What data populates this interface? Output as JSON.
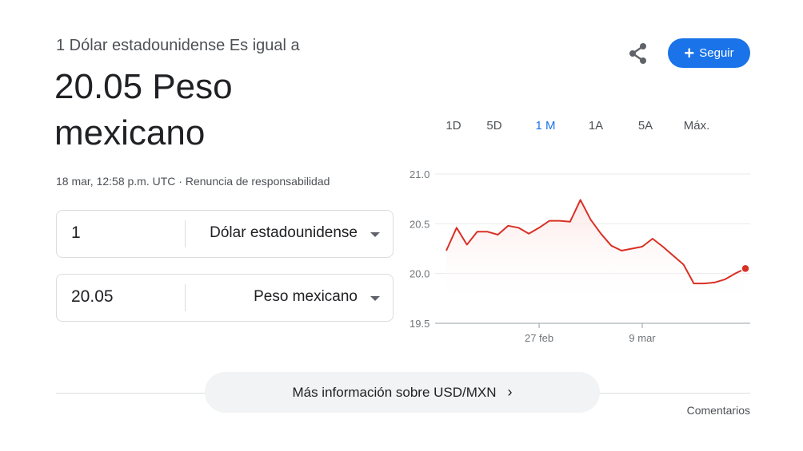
{
  "header": {
    "subtitle": "1 Dólar estadounidense Es igual a",
    "value_line1": "20.05 Peso",
    "value_line2": "mexicano",
    "timestamp": "18 mar, 12:58 p.m. UTC · ",
    "disclaimer": "Renuncia de responsabilidad"
  },
  "actions": {
    "share_icon": "share-icon",
    "follow_label": "Seguir",
    "follow_icon": "+"
  },
  "converter": {
    "from": {
      "amount": "1",
      "unit": "Dólar estadounidense"
    },
    "to": {
      "amount": "20.05",
      "unit": "Peso mexicano"
    }
  },
  "range_tabs": {
    "items": [
      "1D",
      "5D",
      "1 M",
      "1A",
      "5A",
      "Máx."
    ],
    "selected": "1 M"
  },
  "chart_data": {
    "type": "area",
    "x_ticks": [
      "27 feb",
      "9 mar"
    ],
    "y_ticks": [
      "21.0",
      "20.5",
      "20.0",
      "19.5"
    ],
    "ylim": [
      19.5,
      21.0
    ],
    "grid": true,
    "x_index_range": [
      0,
      29
    ],
    "x_tick_positions": [
      9,
      19
    ],
    "color": "#d93025",
    "series": [
      {
        "values": [
          20.23,
          20.46,
          20.29,
          20.42,
          20.42,
          20.39,
          20.48,
          20.46,
          20.4,
          20.46,
          20.53,
          20.53,
          20.52,
          20.74,
          20.54,
          20.4,
          20.28,
          20.23,
          20.25,
          20.27,
          20.35,
          20.27,
          20.18,
          20.09,
          19.9,
          19.9,
          19.91,
          19.94,
          20.0,
          20.05
        ]
      }
    ]
  },
  "footer": {
    "more_info": "Más información sobre USD/MXN",
    "more_info_chevron": "›",
    "feedback": "Comentarios"
  }
}
